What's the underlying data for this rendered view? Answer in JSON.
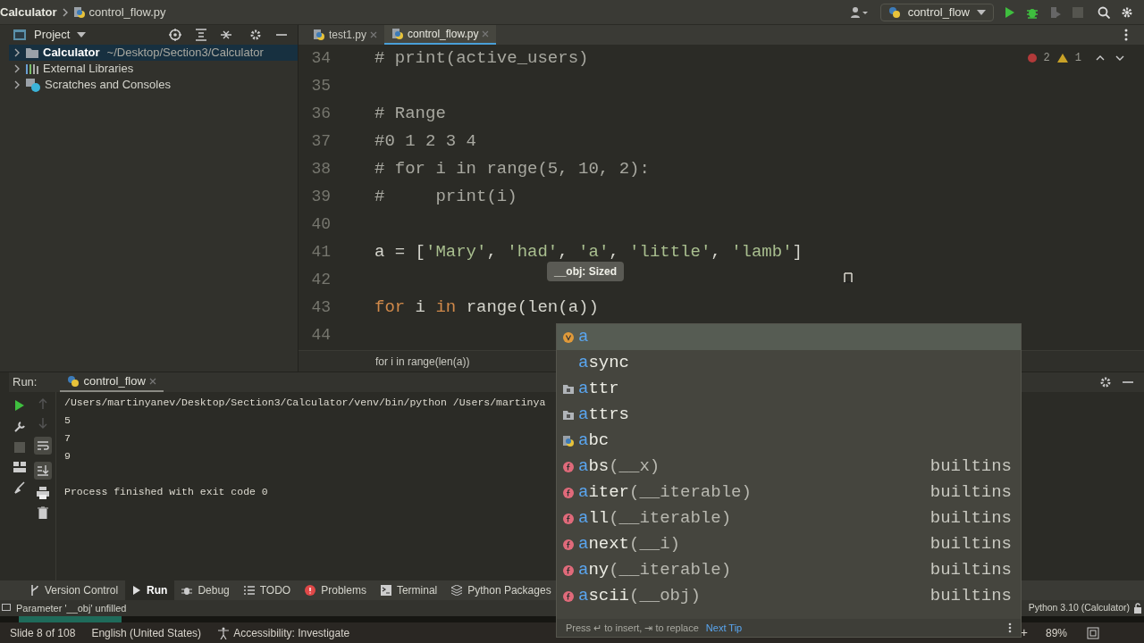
{
  "titlebar": {
    "breadcrumb": [
      "Calculator",
      "control_flow.py"
    ],
    "run_config": "control_flow"
  },
  "project": {
    "title": "Project",
    "items": [
      {
        "name": "Calculator",
        "path": "~/Desktop/Section3/Calculator",
        "kind": "folder",
        "selected": true
      },
      {
        "name": "External Libraries",
        "kind": "libraries",
        "selected": false
      },
      {
        "name": "Scratches and Consoles",
        "kind": "scratches",
        "selected": false
      }
    ]
  },
  "editor": {
    "tabs": [
      {
        "label": "test1.py",
        "selected": false
      },
      {
        "label": "control_flow.py",
        "selected": true
      }
    ],
    "errors": "2",
    "warnings": "1",
    "lines": [
      {
        "number": "34",
        "tokens": [
          {
            "text": "# print(active_users)",
            "kind": "comment"
          }
        ]
      },
      {
        "number": "35"
      },
      {
        "number": "36",
        "tokens": [
          {
            "text": "# Range",
            "kind": "comment"
          }
        ]
      },
      {
        "number": "37",
        "tokens": [
          {
            "text": "#0 1 2 3 4",
            "kind": "comment"
          }
        ]
      },
      {
        "number": "38",
        "tokens": [
          {
            "text": "# for i in range(5, 10, 2):",
            "kind": "comment"
          }
        ]
      },
      {
        "number": "39",
        "tokens": [
          {
            "text": "#     print(i)",
            "kind": "comment"
          }
        ]
      },
      {
        "number": "40"
      },
      {
        "number": "41",
        "tokens": [
          {
            "text": "a = [",
            "kind": "plain"
          },
          {
            "text": "'Mary'",
            "kind": "string"
          },
          {
            "text": ", ",
            "kind": "plain"
          },
          {
            "text": "'had'",
            "kind": "string"
          },
          {
            "text": ", ",
            "kind": "plain"
          },
          {
            "text": "'a'",
            "kind": "string"
          },
          {
            "text": ", ",
            "kind": "plain"
          },
          {
            "text": "'little'",
            "kind": "string"
          },
          {
            "text": ", ",
            "kind": "plain"
          },
          {
            "text": "'lamb'",
            "kind": "string"
          },
          {
            "text": "]",
            "kind": "plain"
          }
        ]
      },
      {
        "number": "42"
      },
      {
        "number": "43",
        "tokens": [
          {
            "text": "for",
            "kind": "keyword"
          },
          {
            "text": " i ",
            "kind": "plain"
          },
          {
            "text": "in",
            "kind": "keyword"
          },
          {
            "text": " range(len(a))",
            "kind": "plain"
          }
        ]
      },
      {
        "number": "44"
      }
    ],
    "breadcrumb": "for i in range(len(a))",
    "tooltip": "__obj: Sized"
  },
  "run": {
    "label": "Run:",
    "tab": "control_flow",
    "output": [
      "/Users/martinyanev/Desktop/Section3/Calculator/venv/bin/python /Users/martinya",
      "5",
      "7",
      "9"
    ],
    "exit_message": "Process finished with exit code 0"
  },
  "completion": {
    "items": [
      {
        "match": "a",
        "kind": "variable",
        "selected": true
      },
      {
        "match": "a",
        "rest": "sync",
        "kind": "keyword",
        "selected": false
      },
      {
        "match": "a",
        "rest": "ttr",
        "kind": "package",
        "selected": false
      },
      {
        "match": "a",
        "rest": "ttrs",
        "kind": "package",
        "selected": false
      },
      {
        "match": "a",
        "rest": "bc",
        "kind": "module",
        "selected": false
      },
      {
        "match": "a",
        "rest": "bs",
        "params": "(__x)",
        "source": "builtins",
        "kind": "function",
        "selected": false
      },
      {
        "match": "a",
        "rest": "iter",
        "params": "(__iterable)",
        "source": "builtins",
        "kind": "function",
        "selected": false
      },
      {
        "match": "a",
        "rest": "ll",
        "params": "(__iterable)",
        "source": "builtins",
        "kind": "function",
        "selected": false
      },
      {
        "match": "a",
        "rest": "next",
        "params": "(__i)",
        "source": "builtins",
        "kind": "function",
        "selected": false
      },
      {
        "match": "a",
        "rest": "ny",
        "params": "(__iterable)",
        "source": "builtins",
        "kind": "function",
        "selected": false
      },
      {
        "match": "a",
        "rest": "scii",
        "params": "(__obj)",
        "source": "builtins",
        "kind": "function",
        "selected": false
      }
    ],
    "hint": "Press ↵ to insert, ⇥ to replace",
    "next_tip": "Next Tip"
  },
  "tool_windows": [
    {
      "label": "Version Control",
      "kind": "branch",
      "selected": false
    },
    {
      "label": "Run",
      "kind": "play",
      "selected": true
    },
    {
      "label": "Debug",
      "kind": "bug",
      "selected": false
    },
    {
      "label": "TODO",
      "kind": "list",
      "selected": false
    },
    {
      "label": "Problems",
      "kind": "error",
      "selected": false
    },
    {
      "label": "Terminal",
      "kind": "terminal",
      "selected": false
    },
    {
      "label": "Python Packages",
      "kind": "layers",
      "selected": false
    }
  ],
  "status": {
    "message": "Parameter '__obj' unfilled",
    "interpreter": "Python 3.10 (Calculator)"
  },
  "app_status": {
    "slide": "Slide 8 of 108",
    "language": "English (United States)",
    "accessibility": "Accessibility: Investigate",
    "zoom_in": "+",
    "zoom": "89%"
  }
}
